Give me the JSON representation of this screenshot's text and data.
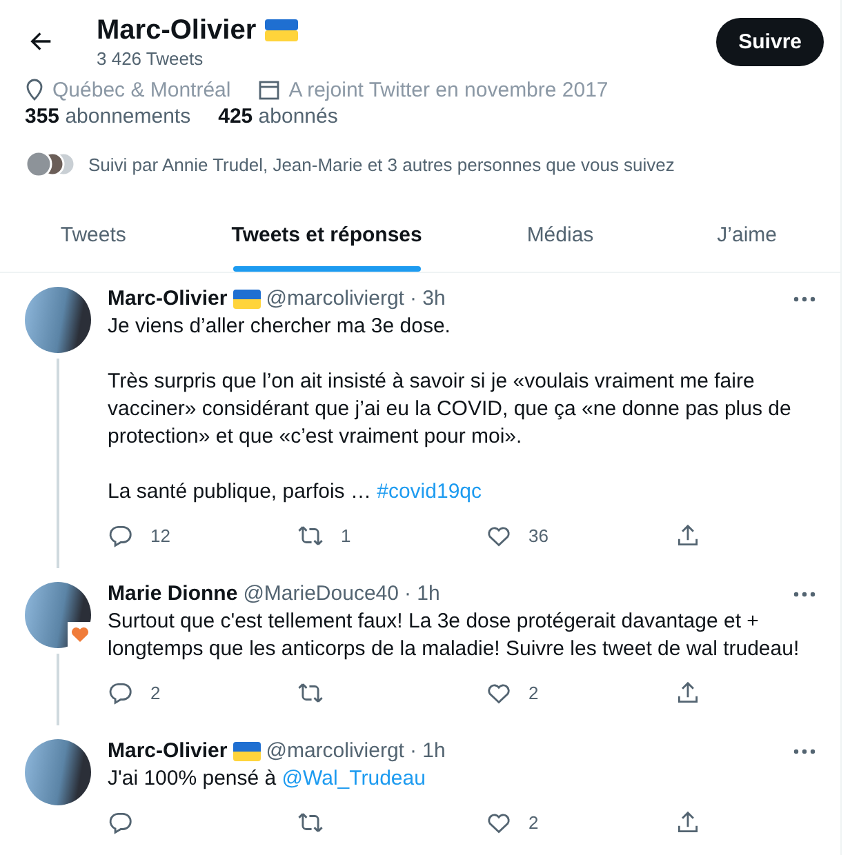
{
  "header": {
    "name": "Marc-Olivier",
    "has_flag": true,
    "tweet_count": "3 426 Tweets",
    "follow_button": "Suivre"
  },
  "profile": {
    "location": "Québec & Montréal",
    "joined": "A rejoint Twitter en novembre 2017",
    "stats": [
      {
        "count": "355",
        "label": "abonnements"
      },
      {
        "count": "425",
        "label": "abonnés"
      }
    ],
    "followed_by": "Suivi par Annie Trudel, Jean-Marie et 3 autres personnes que vous suivez"
  },
  "tabs": [
    {
      "label": "Tweets",
      "selected": false
    },
    {
      "label": "Tweets et réponses",
      "selected": true
    },
    {
      "label": "Médias",
      "selected": false
    },
    {
      "label": "J’aime",
      "selected": false
    }
  ],
  "tweets": [
    {
      "name": "Marc-Olivier",
      "has_flag": true,
      "avatar_badge": false,
      "handle": "@marcoliviergt",
      "time": "· 3h",
      "thread_line": true,
      "paragraphs": [
        [
          {
            "kind": "text",
            "text": "Je viens d’aller chercher ma 3e dose."
          }
        ],
        [
          {
            "kind": "text",
            "text": "Très surpris que l’on ait insisté à savoir si je «voulais vraiment me faire vacciner» considérant que j’ai eu la COVID, que ça «ne donne pas plus de protection» et que «c’est vraiment pour moi»."
          }
        ],
        [
          {
            "kind": "text",
            "text": "La santé publique, parfois … "
          },
          {
            "kind": "link",
            "text": "#covid19qc"
          }
        ]
      ],
      "replies": "12",
      "retweets": "1",
      "likes": "36"
    },
    {
      "name": "Marie Dionne",
      "has_flag": false,
      "avatar_badge": true,
      "handle": "@MarieDouce40",
      "time": "· 1h",
      "thread_line": true,
      "paragraphs": [
        [
          {
            "kind": "text",
            "text": "Surtout que c'est tellement faux! La 3e dose protégerait davantage et + longtemps que les anticorps de la maladie! Suivre les tweet de wal trudeau!"
          }
        ]
      ],
      "replies": "2",
      "likes": "2"
    },
    {
      "name": "Marc-Olivier",
      "has_flag": true,
      "avatar_badge": false,
      "handle": "@marcoliviergt",
      "time": "· 1h",
      "thread_line": false,
      "paragraphs": [
        [
          {
            "kind": "text",
            "text": "J'ai 100% pensé à "
          },
          {
            "kind": "link",
            "text": "@Wal_Trudeau"
          }
        ]
      ],
      "likes": "2"
    }
  ]
}
